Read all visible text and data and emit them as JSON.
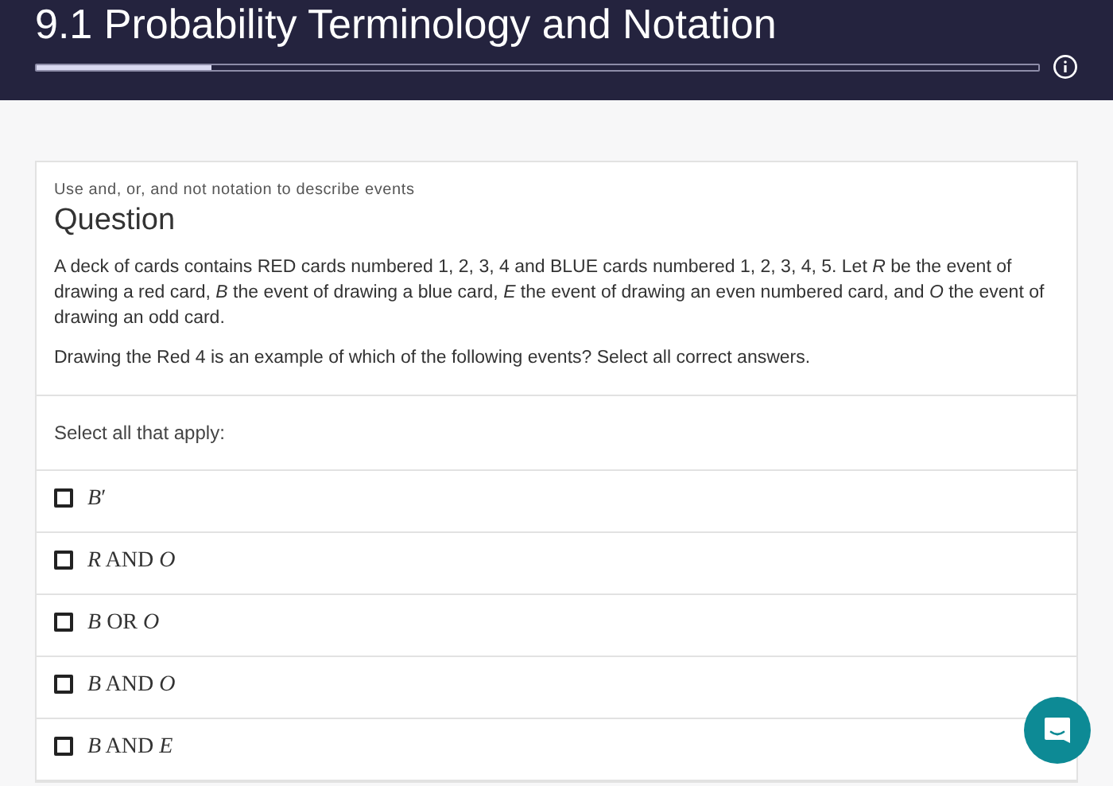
{
  "header": {
    "title": "9.1 Probability Terminology and Notation",
    "progress": {
      "level": 0.175
    }
  },
  "question": {
    "topic": "Use and, or, and not notation to describe events",
    "heading": "Question",
    "paragraphs": [
      "A deck of cards contains RED cards numbered 1, 2, 3, 4 and BLUE cards numbered 1, 2, 3, 4, 5. Let *R* be the event of drawing a red card, *B* the event of drawing a blue card, *E* the event of drawing an even numbered card, and *O* the event of drawing an odd card.",
      "Drawing the Red 4 is an example of which of the following events? Select all correct answers."
    ],
    "instruction": "Select all that apply:",
    "options": [
      {
        "label": "*B*′",
        "checked": false
      },
      {
        "label": "*R* AND *O*",
        "checked": false
      },
      {
        "label": "*B* OR *O*",
        "checked": false
      },
      {
        "label": "*B* AND *O*",
        "checked": false
      },
      {
        "label": "*B* AND *E*",
        "checked": false
      }
    ]
  }
}
